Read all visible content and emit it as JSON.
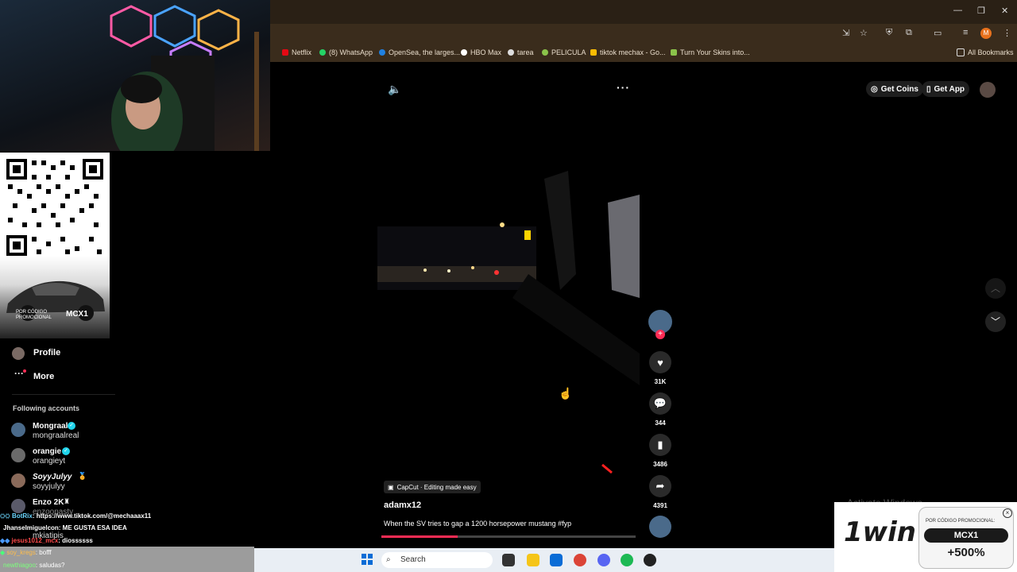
{
  "browser": {
    "bookmarks": [
      {
        "label": "Netflix",
        "color": "#e50914"
      },
      {
        "label": "(8) WhatsApp",
        "color": "#25d366"
      },
      {
        "label": "OpenSea, the larges...",
        "color": "#2081e2"
      },
      {
        "label": "HBO Max",
        "color": "#ffffff"
      },
      {
        "label": "tarea",
        "color": "#dddddd"
      },
      {
        "label": "PELICULA",
        "color": "#8bc34a"
      },
      {
        "label": "tiktok mechax - Go...",
        "color": "#fbbc04"
      },
      {
        "label": "Turn Your Skins into...",
        "color": "#8bc34a"
      }
    ],
    "all_bookmarks": "All Bookmarks",
    "profile_initial": "M"
  },
  "overlay": {
    "qr_code_label": "POR CÓDIGO PROMOCIONAL",
    "qr_code_value": "MCX1"
  },
  "sidebar": {
    "profile_label": "Profile",
    "more_label": "More",
    "following_title": "Following accounts",
    "accounts": [
      {
        "name": "Mongraal",
        "handle": "mongraalreal",
        "verified": true
      },
      {
        "name": "orangie",
        "handle": "orangieyt",
        "verified": true
      },
      {
        "name": "SoyyJulyy",
        "handle": "soyyjulyy",
        "verified": false
      },
      {
        "name": "Enzo 2K",
        "handle": "enzoonasty",
        "verified": false
      }
    ],
    "partial_handle": "mkiatipis"
  },
  "chat": [
    {
      "user": "BotRix",
      "text": ": https://www.tiktok.com/@mechaaax11",
      "color": "#6bd6ff"
    },
    {
      "user": "Jhanselmiguelcon",
      "text": ": ME GUSTA ESA IDEA",
      "color": "#ffffff"
    },
    {
      "user": "jesus1012_mcx",
      "text": ": diossssss",
      "color": "#ff4a4a"
    },
    {
      "user": "soy_kregs",
      "text": ": bofff",
      "color": "#ffbd4a"
    },
    {
      "user": "newthiagoo",
      "text": ": saludas?",
      "color": "#7cff7c"
    }
  ],
  "header": {
    "get_coins": "Get Coins",
    "get_app": "Get App"
  },
  "video": {
    "capcut_label": "CapCut · Editing made easy",
    "author": "adamx12",
    "caption": "When the SV tries to gap a 1200 horsepower mustang #fyp",
    "progress": 0.3
  },
  "actions": {
    "likes": "31K",
    "comments": "344",
    "saves": "3486",
    "shares": "4391"
  },
  "watermark": "Activate Windows",
  "promo": {
    "brand": "1win",
    "code_label": "POR CÓDIGO PROMOCIONAL:",
    "code": "MCX1",
    "bonus": "+500%"
  },
  "taskbar": {
    "search_placeholder": "Search"
  },
  "colors": {
    "accent": "#fe2c55",
    "chrome_bg": "#3a2c1c"
  }
}
